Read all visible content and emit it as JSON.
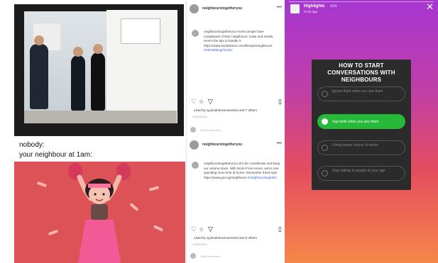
{
  "meme": {
    "caption_top": "nobody:",
    "caption_bottom": "your neighbour at 1am:"
  },
  "posts": [
    {
      "username": "neighbourstogetheryou",
      "body": "neighbourstogetheryou Some people have complained of their neighbours' noise and smells. Here's the tips to handle it. https://www.straitstimes.com/lifestyle/neighbours",
      "hashtag": "#intimidatingcheckin",
      "liked_by": "Liked by sg.kindnessmovement and 7 others",
      "meta": "3 DAYS AGO",
      "comment_placeholder": "Add a comment..."
    },
    {
      "username": "neighbourstogetheryou",
      "body": "neighbourstogetheryou Let's be considerate and keep our volume down. With Work-From-Home, we're now spending more time at home. Remember these tips! https://www.gov.sg/neighbours",
      "hashtag": "#neighbourstogether",
      "liked_by": "Liked by sg.kindnessmovement and 8 others",
      "meta": "3 DAYS AGO",
      "comment_placeholder": "Add a comment..."
    }
  ],
  "story": {
    "username": "Highlights",
    "time": "50s",
    "subtitle": "From ago",
    "close_icon": "close-icon",
    "title": "HOW TO START CONVERSATIONS WITH NEIGHBOURS",
    "options": [
      {
        "text": "Ignore them when you see them",
        "selected": false
      },
      {
        "text": "Say hello when you see them",
        "selected": true
      },
      {
        "text": "Using proper choice of words",
        "selected": false
      },
      {
        "text": "Stop talking to people at your age",
        "selected": false
      }
    ]
  },
  "icons": {
    "like": "heart-icon",
    "comment": "comment-icon",
    "share": "share-icon",
    "save": "bookmark-icon",
    "more": "more-options-icon"
  }
}
